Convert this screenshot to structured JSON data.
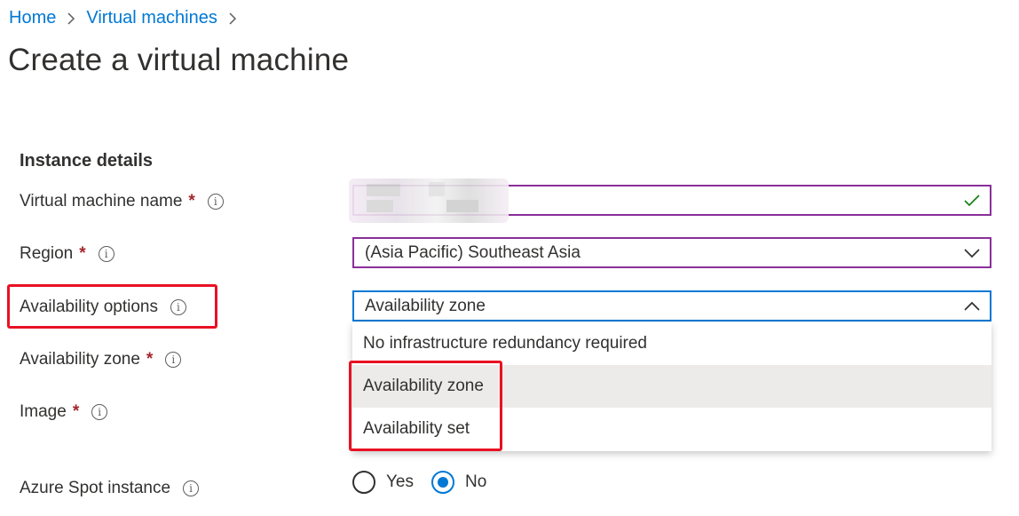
{
  "breadcrumb": {
    "home": "Home",
    "virtual_machines": "Virtual machines"
  },
  "page_title": "Create a virtual machine",
  "section_title": "Instance details",
  "fields": {
    "vm_name": {
      "label": "Virtual machine name",
      "required": "*",
      "value": ""
    },
    "region": {
      "label": "Region",
      "required": "*",
      "value": "(Asia Pacific) Southeast Asia"
    },
    "availability_options": {
      "label": "Availability options",
      "value": "Availability zone"
    },
    "availability_zone": {
      "label": "Availability zone",
      "required": "*"
    },
    "image": {
      "label": "Image",
      "required": "*"
    },
    "spot": {
      "label": "Azure Spot instance",
      "yes": "Yes",
      "no": "No",
      "selected": "No"
    }
  },
  "availability_dropdown": {
    "options": [
      "No infrastructure redundancy required",
      "Availability zone",
      "Availability set"
    ],
    "selected": "Availability zone"
  },
  "info_glyph": "i",
  "colors": {
    "accent": "#0078d4",
    "required": "#a4262c",
    "valid_check": "#107c10",
    "focused_border": "#0078d4",
    "field_border": "#8a2f9a",
    "highlight": "#e81123"
  }
}
